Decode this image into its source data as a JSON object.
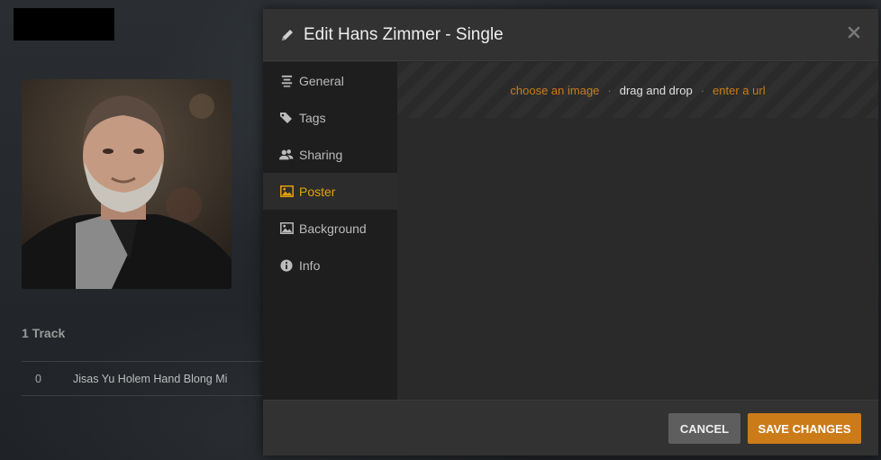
{
  "background": {
    "tracks_heading": "1 Track",
    "tracks": [
      {
        "number": "0",
        "title": "Jisas Yu Holem Hand Blong Mi"
      }
    ]
  },
  "modal": {
    "title": "Edit Hans Zimmer - Single",
    "close_icon": "close-icon",
    "nav": [
      {
        "label": "General",
        "icon": "list-icon",
        "active": false
      },
      {
        "label": "Tags",
        "icon": "tag-icon",
        "active": false
      },
      {
        "label": "Sharing",
        "icon": "users-icon",
        "active": false
      },
      {
        "label": "Poster",
        "icon": "image-icon",
        "active": true
      },
      {
        "label": "Background",
        "icon": "image-icon",
        "active": false
      },
      {
        "label": "Info",
        "icon": "info-icon",
        "active": false
      }
    ],
    "dropzone": {
      "choose_image": "choose an image",
      "separator": "·",
      "drag_drop": "drag and drop",
      "enter_url": "enter a url"
    },
    "footer": {
      "cancel_label": "CANCEL",
      "save_label": "SAVE CHANGES"
    }
  },
  "colors": {
    "accent": "#cc7b19",
    "active_nav": "#e5a00d"
  }
}
